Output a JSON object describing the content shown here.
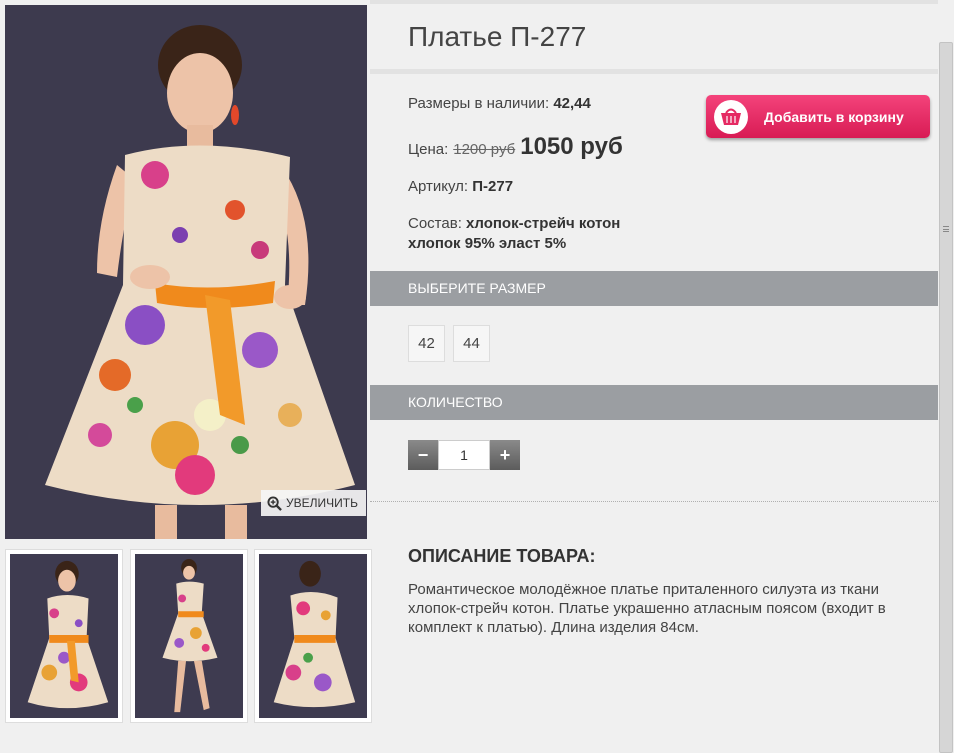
{
  "product": {
    "title": "Платье П-277",
    "sizes_label": "Размеры в наличии:",
    "sizes_value": "42,44",
    "price_label": "Цена:",
    "old_price": "1200 руб",
    "new_price": "1050 руб",
    "article_label": "Артикул:",
    "article_value": "П-277",
    "composition_label": "Состав:",
    "composition_line1": "хлопок-стрейч котон",
    "composition_line2": "хлопок 95% эласт 5%"
  },
  "cart": {
    "label": "Добавить в корзину",
    "icon": "basket-icon",
    "color": "#e52a63"
  },
  "gallery": {
    "zoom_label": "УВЕЛИЧИТЬ",
    "zoom_icon": "magnifier-plus-icon",
    "thumb_count": 3
  },
  "size_section": {
    "title": "ВЫБЕРИТЕ РАЗМЕР",
    "options": [
      "42",
      "44"
    ]
  },
  "qty_section": {
    "title": "КОЛИЧЕСТВО",
    "minus": "−",
    "plus": "+",
    "value": "1"
  },
  "description": {
    "title": "ОПИСАНИЕ ТОВАРА:",
    "text": "Романтическое молодёжное платье приталенного силуэта из ткани хлопок-стрейч котон. Платье украшенно атласным поясом (входит в комплект к платью). Длина изделия 84см."
  },
  "colors": {
    "section_bar": "#9b9ea2",
    "photo_bg": "#3d3a4e",
    "belt": "#f08a1c"
  }
}
